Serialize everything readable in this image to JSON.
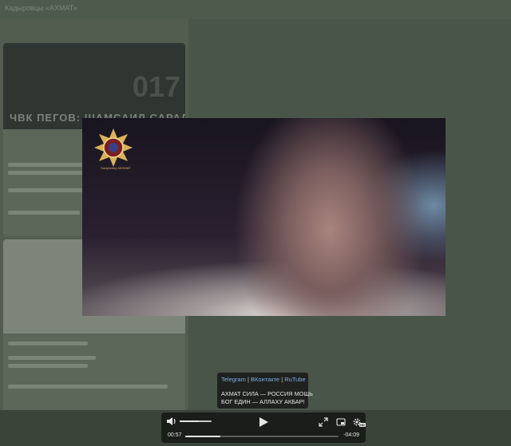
{
  "header": {
    "title": "Кадыровцы «АХМАТ»"
  },
  "background_thumb": {
    "headline": "ЧВК ПЕГОВ: ШАМСАИЛ САРАЛИЕВ",
    "number": "017"
  },
  "video": {
    "logo_caption": "Kadyrovtsy AKHMAT"
  },
  "caption": {
    "links": [
      "Telegram",
      "ВКонтакте",
      "RuTube"
    ],
    "separator": "|",
    "line1": "АХМАТ СИЛА — РОССИЯ МОЩЬ",
    "line2": "БОГ ЕДИН — АЛЛАХУ АКБАР!"
  },
  "player": {
    "current_time": "00:57",
    "remaining_time": "-04:09",
    "progress": 0.23,
    "volume": 0.6,
    "quality_badge": "HD"
  },
  "colors": {
    "link": "#7fb0e8",
    "logo_gold": "#d9b25a"
  }
}
